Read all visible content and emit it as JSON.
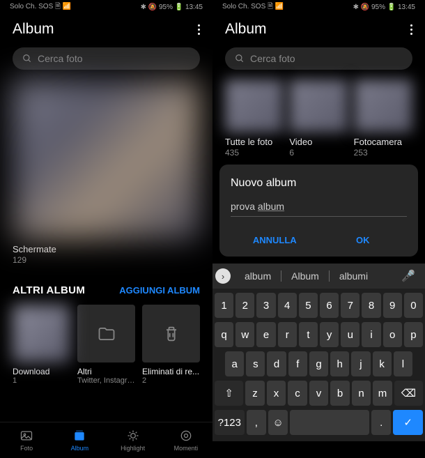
{
  "statusbar": {
    "left": "Solo Ch. SOS 🗎 📶",
    "right": "✱ 🔕 95% 🔋 13:45"
  },
  "header": {
    "title": "Album"
  },
  "search": {
    "placeholder": "Cerca foto"
  },
  "left_screen": {
    "main_album": {
      "label": "Schermate",
      "count": "129"
    },
    "section_title": "ALTRI ALBUM",
    "add_label": "AGGIUNGI ALBUM",
    "altri": [
      {
        "label": "Download",
        "sub": "1"
      },
      {
        "label": "Altri",
        "sub": "Twitter, Instagra..."
      },
      {
        "label": "Eliminati di re...",
        "sub": "2"
      }
    ]
  },
  "bottomnav": [
    {
      "label": "Foto"
    },
    {
      "label": "Album"
    },
    {
      "label": "Highlight"
    },
    {
      "label": "Momenti"
    }
  ],
  "right_screen": {
    "strip": [
      {
        "label": "Tutte le foto",
        "count": "435"
      },
      {
        "label": "Video",
        "count": "6"
      },
      {
        "label": "Fotocamera",
        "count": "253"
      }
    ],
    "dialog": {
      "title": "Nuovo album",
      "input_prefix": "prova ",
      "input_underlined": "album",
      "cancel": "ANNULLA",
      "ok": "OK"
    }
  },
  "keyboard": {
    "suggestions": [
      "album",
      "Album",
      "albumi"
    ],
    "row1": [
      "1",
      "2",
      "3",
      "4",
      "5",
      "6",
      "7",
      "8",
      "9",
      "0"
    ],
    "row2": [
      "q",
      "w",
      "e",
      "r",
      "t",
      "y",
      "u",
      "i",
      "o",
      "p"
    ],
    "row3": [
      "a",
      "s",
      "d",
      "f",
      "g",
      "h",
      "j",
      "k",
      "l"
    ],
    "row4_mid": [
      "z",
      "x",
      "c",
      "v",
      "b",
      "n",
      "m"
    ],
    "shift": "⇧",
    "backspace": "⌫",
    "sym": "?123",
    "comma": ",",
    "emoji": "☺",
    "space": " ",
    "period": ".",
    "enter": "✓"
  }
}
